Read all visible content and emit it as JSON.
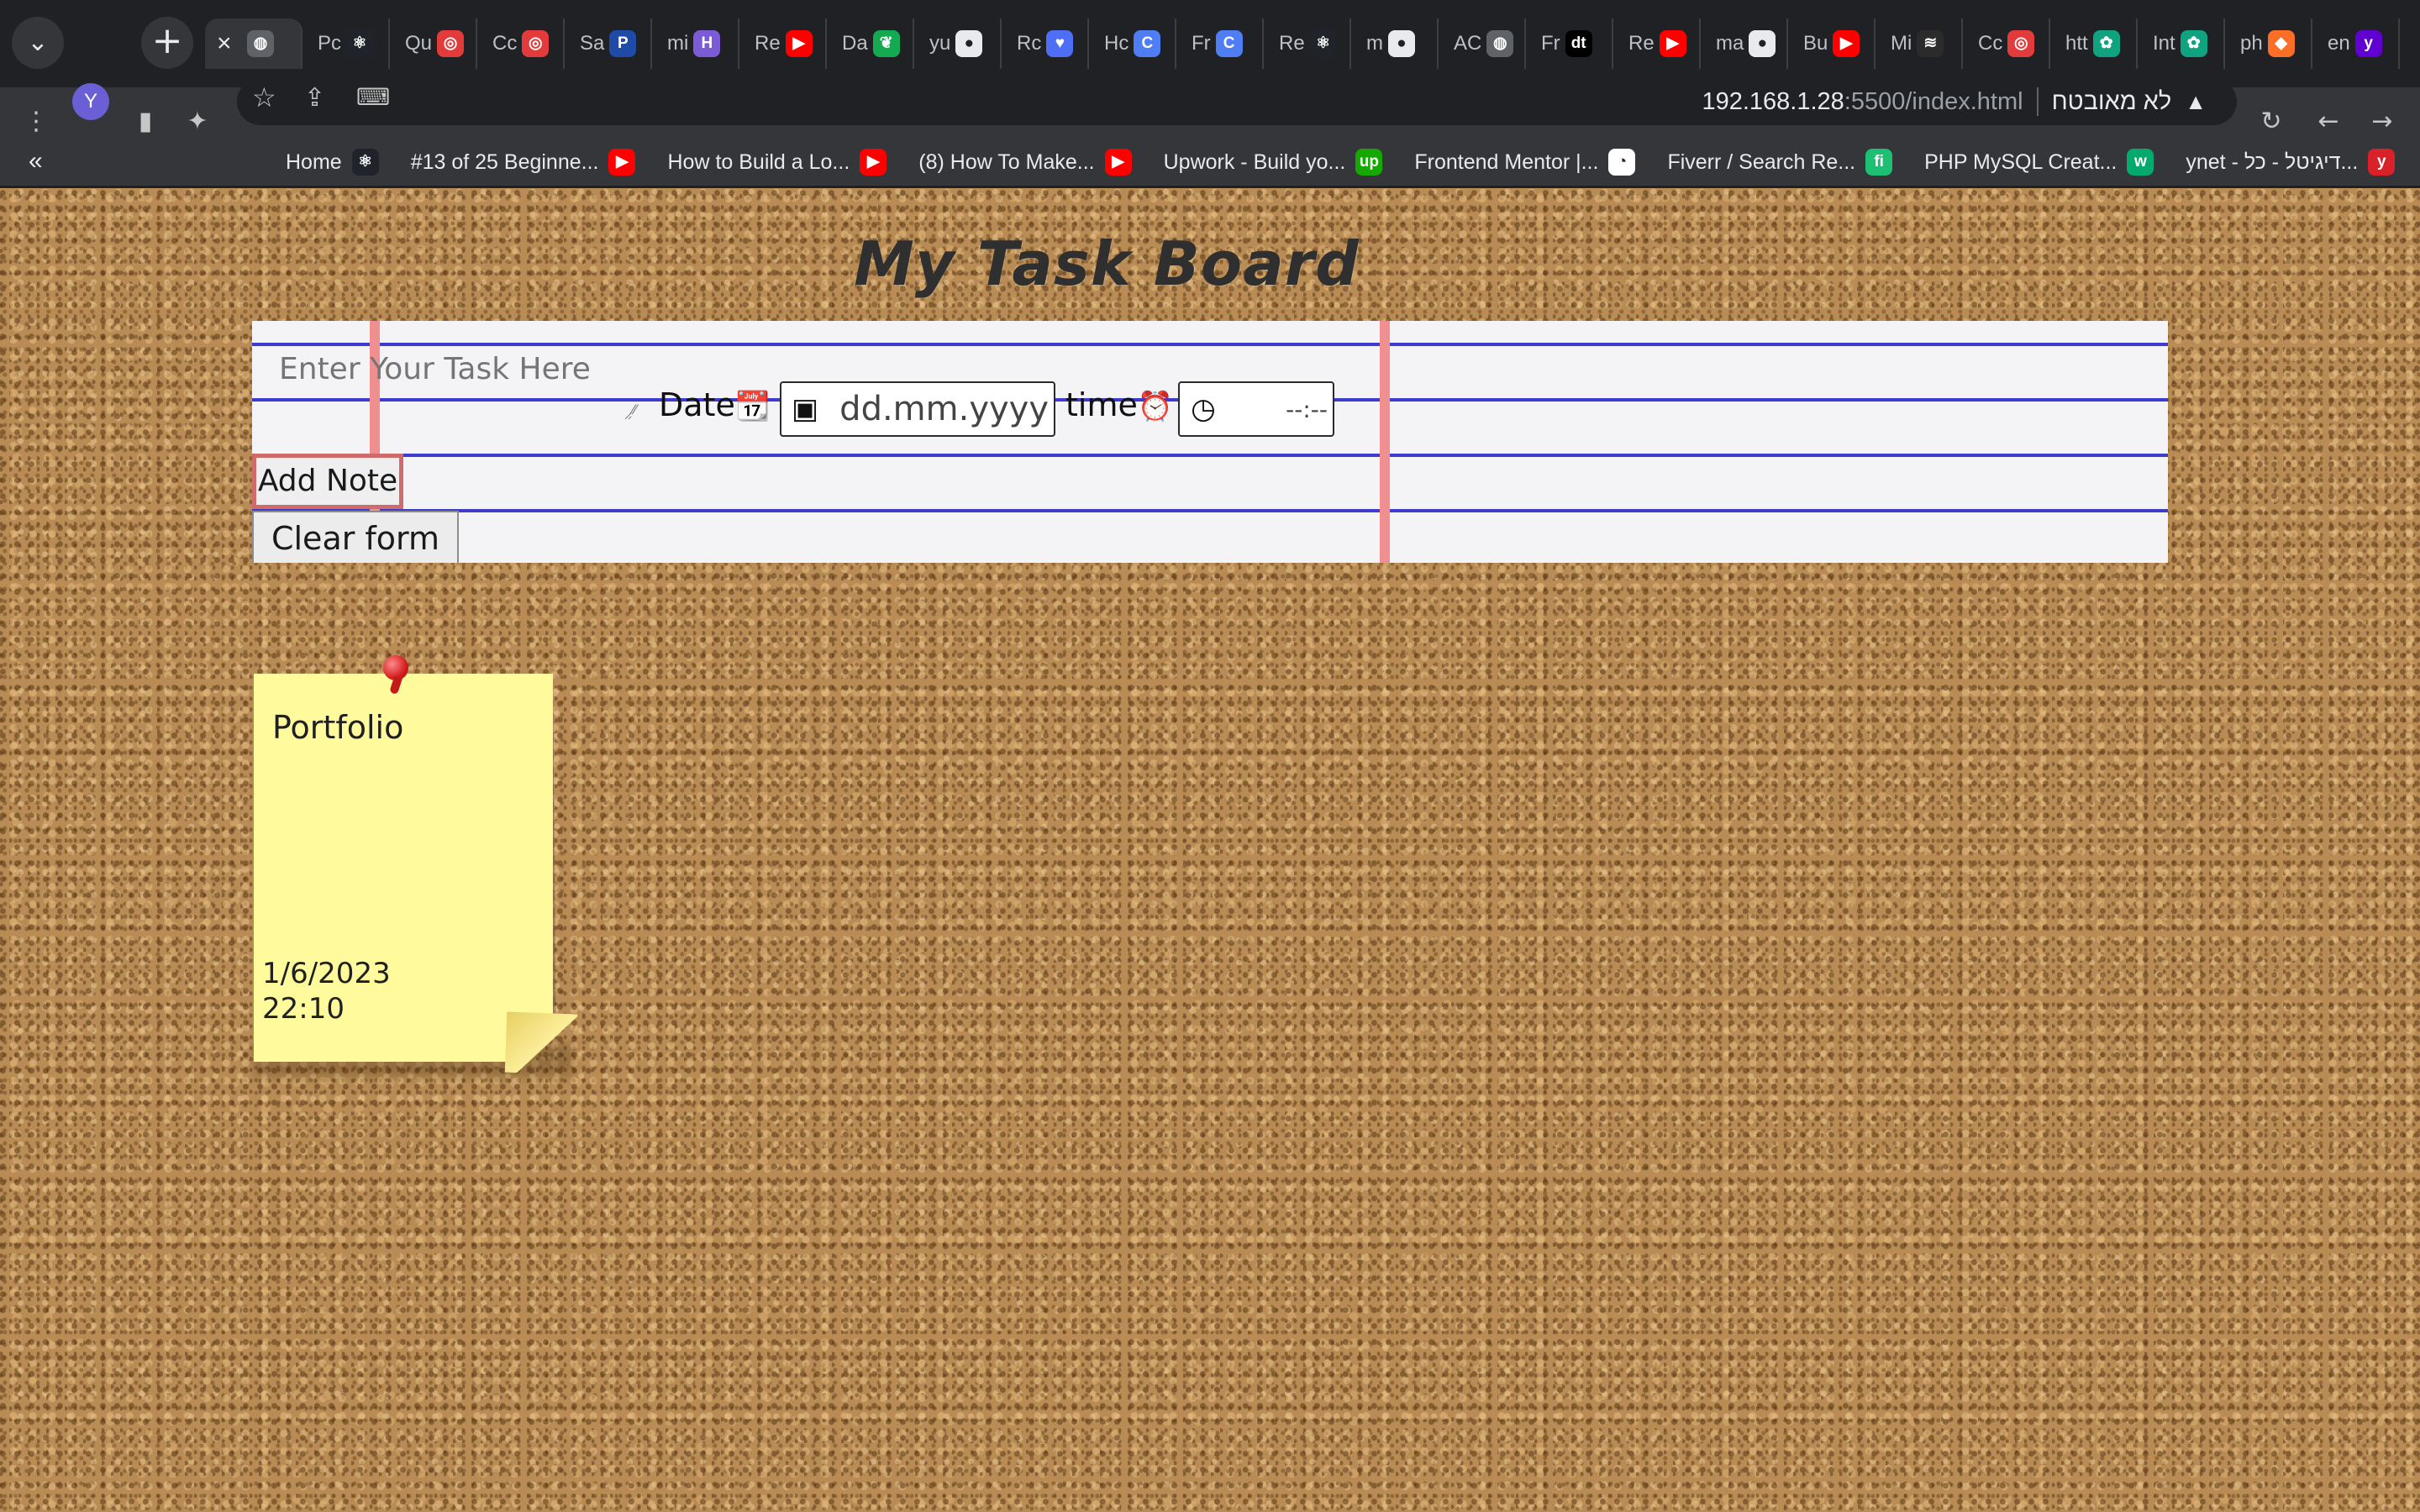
{
  "browser": {
    "tabs": [
      {
        "label": "",
        "icon": "globe-icon",
        "active": true
      },
      {
        "label": "Pc",
        "icon": "react-icon"
      },
      {
        "label": "Qu",
        "icon": "lifebuoy-icon"
      },
      {
        "label": "Cc",
        "icon": "lifebuoy-icon"
      },
      {
        "label": "Sa",
        "icon": "paypal-icon"
      },
      {
        "label": "mi",
        "icon": "h-icon"
      },
      {
        "label": "Re",
        "icon": "youtube-icon"
      },
      {
        "label": "Da",
        "icon": "mongodb-icon"
      },
      {
        "label": "yu",
        "icon": "github-icon"
      },
      {
        "label": "Rc",
        "icon": "heart-icon"
      },
      {
        "label": "Hc",
        "icon": "c-icon"
      },
      {
        "label": "Fr",
        "icon": "c-icon"
      },
      {
        "label": "Re",
        "icon": "react-icon"
      },
      {
        "label": "m",
        "icon": "github-icon"
      },
      {
        "label": "AC",
        "icon": "globe-icon"
      },
      {
        "label": "Fr",
        "icon": "dt-icon"
      },
      {
        "label": "Re",
        "icon": "youtube-icon"
      },
      {
        "label": "ma",
        "icon": "github-icon"
      },
      {
        "label": "Bu",
        "icon": "youtube-icon"
      },
      {
        "label": "Mi",
        "icon": "stack-icon"
      },
      {
        "label": "Cc",
        "icon": "lifebuoy-icon"
      },
      {
        "label": "htt",
        "icon": "openai-icon"
      },
      {
        "label": "Int",
        "icon": "openai-icon"
      },
      {
        "label": "ph",
        "icon": "gitlab-icon"
      },
      {
        "label": "en",
        "icon": "yahoo-icon"
      }
    ],
    "profile_initial": "Y",
    "url_host": "192.168.1.28",
    "url_path": ":5500/index.html",
    "security_label": "לא מאובטח",
    "bookmarks_chevron": "«",
    "bookmarks": [
      {
        "label": "Home",
        "icon": "react-icon"
      },
      {
        "label": "#13 of 25 Beginne...",
        "icon": "youtube-icon"
      },
      {
        "label": "How to Build a Lo...",
        "icon": "youtube-icon"
      },
      {
        "label": "(8) How To Make...",
        "icon": "youtube-icon"
      },
      {
        "label": "Upwork - Build yo...",
        "icon": "upwork-icon"
      },
      {
        "label": "Frontend Mentor |...",
        "icon": "frontend-mentor-icon"
      },
      {
        "label": "Fiverr / Search Re...",
        "icon": "fiverr-icon"
      },
      {
        "label": "PHP MySQL Creat...",
        "icon": "w3-icon"
      },
      {
        "label": "ynet - דיגיטל - כל...",
        "icon": "ynet-icon"
      }
    ]
  },
  "page": {
    "title": "My Task Board",
    "form": {
      "task_placeholder": "Enter Your Task Here",
      "date_label": "Date",
      "date_emoji": "📆",
      "date_placeholder": "dd.mm.yyyy",
      "time_label": "time",
      "time_emoji": "⏰",
      "time_placeholder": "--:--",
      "add_button": "Add Note",
      "clear_button": "Clear form"
    },
    "notes": [
      {
        "title": "Portfolio",
        "date": "1/6/2023",
        "time": "22:10"
      }
    ]
  },
  "colors": {
    "cork": "#b98c55",
    "paper": "#f4f3f6",
    "paper_rule": "#3d3ccf",
    "paper_margin": "#ef8f8f",
    "note": "#fffa9c",
    "pin": "#d41e1e"
  }
}
